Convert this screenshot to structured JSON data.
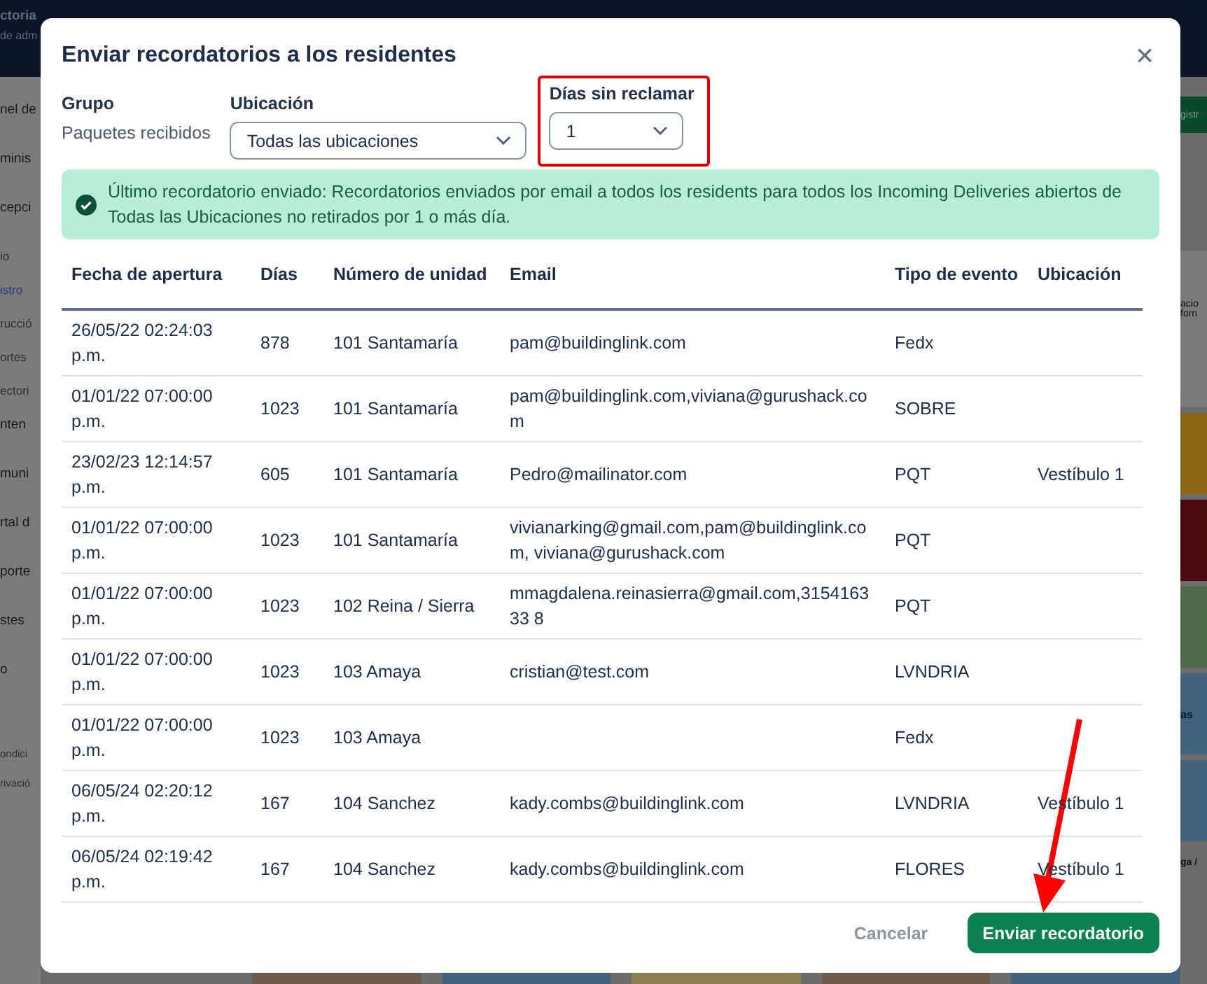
{
  "background": {
    "header": [
      "ctoria",
      "de adm"
    ],
    "sidebar_items": [
      {
        "label": "nel de",
        "kind": "section"
      },
      {
        "label": "minis",
        "kind": "section"
      },
      {
        "label": "cepci",
        "kind": "section"
      },
      {
        "label": "io",
        "kind": "sub",
        "selected": false
      },
      {
        "label": "istro",
        "kind": "sub",
        "selected": true
      },
      {
        "label": "rucció",
        "kind": "sub",
        "selected": false
      },
      {
        "label": "ortes",
        "kind": "sub",
        "selected": false
      },
      {
        "label": "ectori",
        "kind": "sub",
        "selected": false
      },
      {
        "label": "nten",
        "kind": "section"
      },
      {
        "label": "muni",
        "kind": "section"
      },
      {
        "label": "rtal d",
        "kind": "section"
      },
      {
        "label": "porte",
        "kind": "section"
      },
      {
        "label": "stes",
        "kind": "section"
      },
      {
        "label": "o",
        "kind": "section"
      },
      {
        "label": "ondici",
        "kind": "legal"
      },
      {
        "label": "rivació",
        "kind": "legal"
      }
    ],
    "right_items": [
      {
        "kind": "button",
        "label": "gistr"
      },
      {
        "kind": "card",
        "label": "acio"
      },
      {
        "kind": "card_line",
        "label": "forn"
      },
      {
        "kind": "tile",
        "color": "#8a6414"
      },
      {
        "kind": "tile",
        "color": "#4a0a10"
      },
      {
        "kind": "tile",
        "color": "#4e6a4a"
      },
      {
        "kind": "tile",
        "color": "#42627f",
        "label": "as"
      },
      {
        "kind": "tile",
        "color": "#42627f"
      },
      {
        "kind": "text",
        "label": "ga /"
      }
    ],
    "bottom_tiles": [
      {
        "color": "#6e5a4a"
      },
      {
        "color": "#42627f"
      },
      {
        "color": "#8c8050"
      },
      {
        "color": "#6e5a4a"
      },
      {
        "color": "#42627f"
      }
    ]
  },
  "dialog": {
    "title": "Enviar recordatorios a los residentes",
    "close": "×",
    "group": {
      "label": "Grupo",
      "value": "Paquetes recibidos"
    },
    "location": {
      "label": "Ubicación",
      "value": "Todas las ubicaciones"
    },
    "days": {
      "label": "Días sin reclamar",
      "value": "1"
    },
    "alert": "Último recordatorio enviado: Recordatorios enviados por email a todos los residents para todos los Incoming Deliveries abiertos de Todas las Ubicaciones no retirados por 1 o más día.",
    "table": {
      "columns": [
        "Fecha de apertura",
        "Días",
        "Número de unidad",
        "Email",
        "Tipo de evento",
        "Ubicación"
      ],
      "rows": [
        {
          "date": "26/05/22 02:24:03 p.m.",
          "days": "878",
          "unit": "101 Santamaría",
          "email": "pam@buildinglink.com",
          "type": "Fedx"
        },
        {
          "date": "01/01/22 07:00:00 p.m.",
          "days": "1023",
          "unit": "101 Santamaría",
          "email": "pam@buildinglink.com,viviana@gurushack.com",
          "type": "SOBRE"
        },
        {
          "date": "23/02/23 12:14:57 p.m.",
          "days": "605",
          "unit": "101 Santamaría",
          "email": "Pedro@mailinator.com",
          "type": "PQT",
          "location": "Vestíbulo 1"
        },
        {
          "date": "01/01/22 07:00:00 p.m.",
          "days": "1023",
          "unit": "101 Santamaría",
          "email": "vivianarking@gmail.com,pam@buildinglink.com, viviana@gurushack.com",
          "type": "PQT"
        },
        {
          "date": "01/01/22 07:00:00 p.m.",
          "days": "1023",
          "unit": "102 Reina / Sierra",
          "email": "mmagdalena.reinasierra@gmail.com,315416333 8",
          "type": "PQT"
        },
        {
          "date": "01/01/22 07:00:00 p.m.",
          "days": "1023",
          "unit": "103 Amaya",
          "email": "cristian@test.com",
          "type": "LVNDRIA"
        },
        {
          "date": "01/01/22 07:00:00 p.m.",
          "days": "1023",
          "unit": "103 Amaya",
          "type": "Fedx"
        },
        {
          "date": "06/05/24 02:20:12 p.m.",
          "days": "167",
          "unit": "104 Sanchez",
          "email": "kady.combs@buildinglink.com",
          "type": "LVNDRIA",
          "location": "Vestíbulo 1"
        },
        {
          "date": "06/05/24 02:19:42 p.m.",
          "days": "167",
          "unit": "104 Sanchez",
          "email": "kady.combs@buildinglink.com",
          "type": "FLORES",
          "location": "Vestíbulo 1"
        }
      ]
    },
    "buttons": {
      "cancel": "Cancelar",
      "submit": "Enviar recordatorio"
    }
  }
}
